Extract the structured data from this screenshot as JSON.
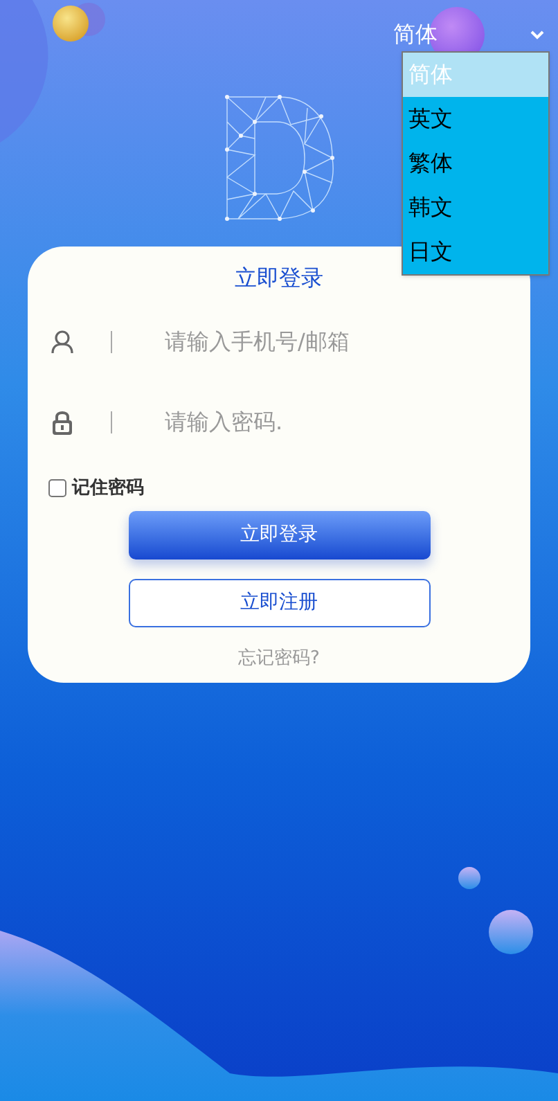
{
  "language_select": {
    "value": "简体",
    "options": [
      {
        "label": "简体",
        "selected": true
      },
      {
        "label": "英文",
        "selected": false
      },
      {
        "label": "繁体",
        "selected": false
      },
      {
        "label": "韩文",
        "selected": false
      },
      {
        "label": "日文",
        "selected": false
      }
    ]
  },
  "login_card": {
    "title": "立即登录",
    "fields": [
      {
        "kind": "user",
        "placeholder": "请输入手机号/邮箱"
      },
      {
        "kind": "password",
        "placeholder": "请输入密码."
      }
    ],
    "remember": {
      "label": "记住密码",
      "checked": false
    },
    "login_button": "立即登录",
    "register_button": "立即注册",
    "forgot_link": "忘记密码?"
  }
}
